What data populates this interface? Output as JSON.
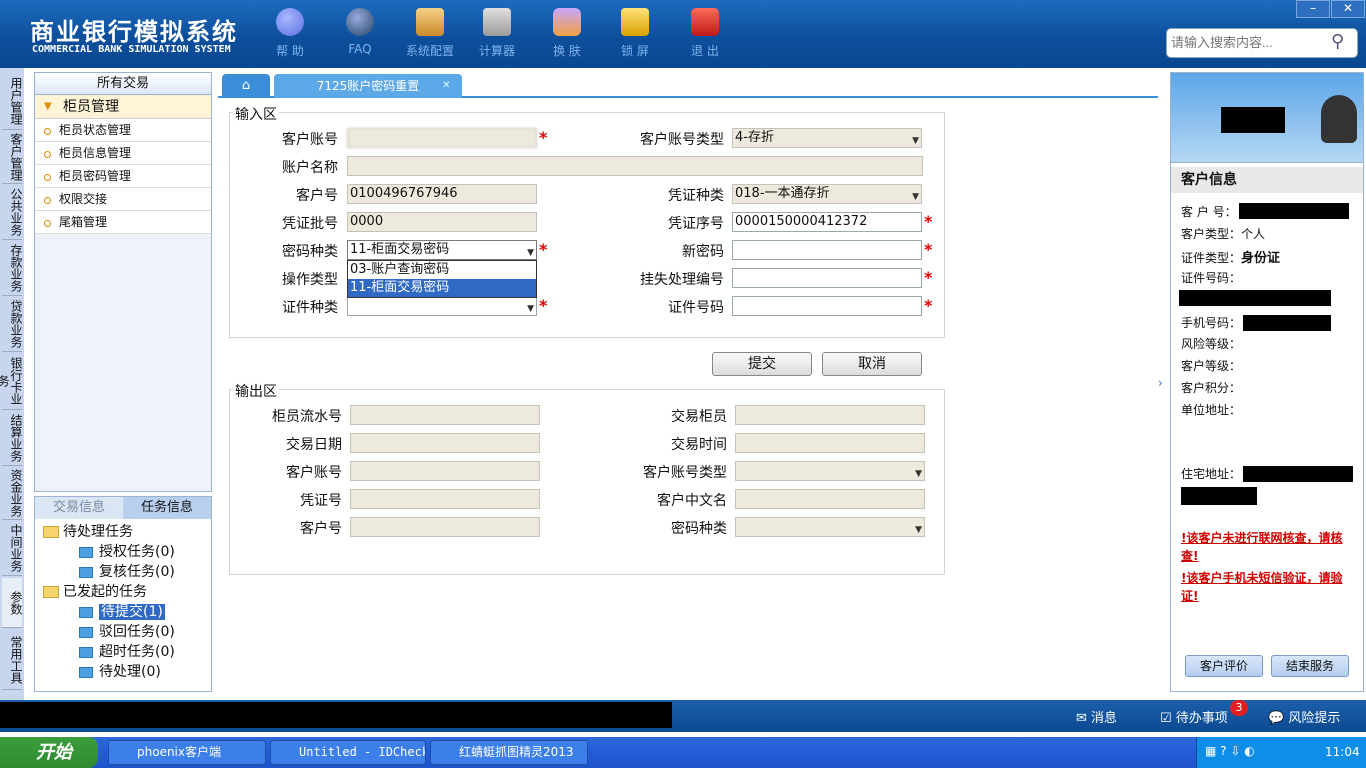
{
  "app": {
    "title": "商业银行模拟系统",
    "subtitle": "COMMERCIAL BANK SIMULATION SYSTEM"
  },
  "toolbar": {
    "help": "帮 助",
    "faq": "FAQ",
    "config": "系统配置",
    "calculator": "计算器",
    "skin": "换 肤",
    "lock": "锁 屏",
    "exit": "退 出"
  },
  "search": {
    "placeholder": "请输入搜索内容..."
  },
  "window": {
    "minimize": "–",
    "close": "✕"
  },
  "left_tabs": [
    "用户管理",
    "客户管理",
    "公共业务",
    "存款业务",
    "贷款业务",
    "银行卡业务",
    "结算业务",
    "资金业务",
    "中间业务",
    "参数",
    "常用工具"
  ],
  "menu": {
    "header": "所有交易",
    "group": "柜员管理",
    "items": [
      "柜员状态管理",
      "柜员信息管理",
      "柜员密码管理",
      "权限交接",
      "尾箱管理"
    ]
  },
  "tasks": {
    "tab_trade": "交易信息",
    "tab_task": "任务信息",
    "pending": "待处理任务",
    "auth": "授权任务(0)",
    "review": "复核任务(0)",
    "initiated": "已发起的任务",
    "to_submit": "待提交(1)",
    "rejected": "驳回任务(0)",
    "timeout": "超时任务(0)",
    "to_handle": "待处理(0)"
  },
  "tabs": {
    "current": "7125账户密码重置",
    "close": "✕"
  },
  "input": {
    "legend": "输入区",
    "acct_no": "客户账号",
    "acct_no_val": "",
    "acct_type": "客户账号类型",
    "acct_type_val": "4-存折",
    "acct_name": "账户名称",
    "acct_name_val": "",
    "cust_no": "客户号",
    "cust_no_val": "0100496767946",
    "voucher_type": "凭证种类",
    "voucher_type_val": "018-一本通存折",
    "voucher_batch": "凭证批号",
    "voucher_batch_val": "0000",
    "voucher_seq": "凭证序号",
    "voucher_seq_val": "0000150000412372",
    "pwd_type": "密码种类",
    "pwd_type_val": "11-柜面交易密码",
    "new_pwd": "新密码",
    "op_type": "操作类型",
    "loss_no": "挂失处理编号",
    "id_type": "证件种类",
    "id_no": "证件号码",
    "dropdown": [
      "03-账户查询密码",
      "11-柜面交易密码"
    ]
  },
  "buttons": {
    "submit": "提交",
    "cancel": "取消"
  },
  "output": {
    "legend": "输出区",
    "teller_seq": "柜员流水号",
    "trade_teller": "交易柜员",
    "trade_date": "交易日期",
    "trade_time": "交易时间",
    "acct_no": "客户账号",
    "acct_type": "客户账号类型",
    "voucher_no": "凭证号",
    "cn_name": "客户中文名",
    "cust_no": "客户号",
    "pwd_type": "密码种类"
  },
  "customer": {
    "title": "客户信息",
    "cust_no": "客 户 号：",
    "cust_type": "客户类型：",
    "cust_type_val": "个人",
    "id_type": "证件类型：",
    "id_type_val": "身份证",
    "id_no": "证件号码：",
    "phone": "手机号码：",
    "risk": "风险等级：",
    "level": "客户等级：",
    "points": "客户积分：",
    "company_addr": "单位地址：",
    "home_addr": "住宅地址：",
    "warn1": "!该客户未进行联网核查，请核查!",
    "warn2": "!该客户手机未短信验证，请验证!",
    "eval": "客户评价",
    "end": "结束服务"
  },
  "status": {
    "msg": "消息",
    "todo": "待办事项",
    "todo_count": "3",
    "risk": "风险提示"
  },
  "taskbar": {
    "start": "开始",
    "item1": "phoenix客户端",
    "item2": "Untitled - IDCheck",
    "item3": "红蜻蜓抓图精灵2013",
    "clock": "11:04"
  },
  "colors": {
    "brand": "#0d4f9c",
    "required": "#d00000",
    "warning": "#cc0000"
  }
}
